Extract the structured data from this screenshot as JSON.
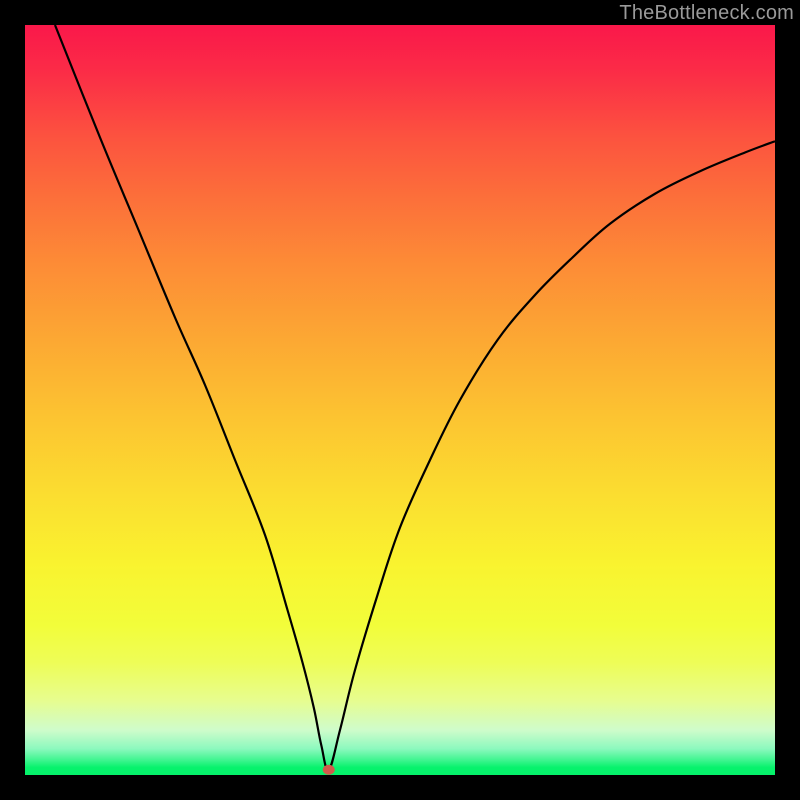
{
  "watermark": {
    "text": "TheBottleneck.com"
  },
  "colors": {
    "page_bg": "#000000",
    "curve_stroke": "#000000",
    "min_dot_fill": "#d15a4b",
    "gradient_top": "#fa184a",
    "gradient_bottom": "#05f16a"
  },
  "chart_data": {
    "type": "line",
    "title": "",
    "xlabel": "",
    "ylabel": "",
    "xlim": [
      0,
      100
    ],
    "ylim": [
      0,
      100
    ],
    "grid": false,
    "legend": false,
    "x": [
      4,
      10,
      15,
      20,
      24,
      28,
      32,
      35,
      37,
      38.5,
      39.5,
      40.5,
      42,
      44,
      47,
      50,
      54,
      58,
      63,
      68,
      73,
      78,
      84,
      90,
      96,
      100
    ],
    "values": [
      100,
      85,
      73,
      61,
      52,
      42,
      32,
      22,
      15,
      9,
      4,
      0.7,
      6,
      14,
      24,
      33,
      42,
      50,
      58,
      64,
      69,
      73.5,
      77.5,
      80.5,
      83,
      84.5
    ],
    "min_point": {
      "x": 40.5,
      "y": 0.7
    },
    "annotations": []
  }
}
